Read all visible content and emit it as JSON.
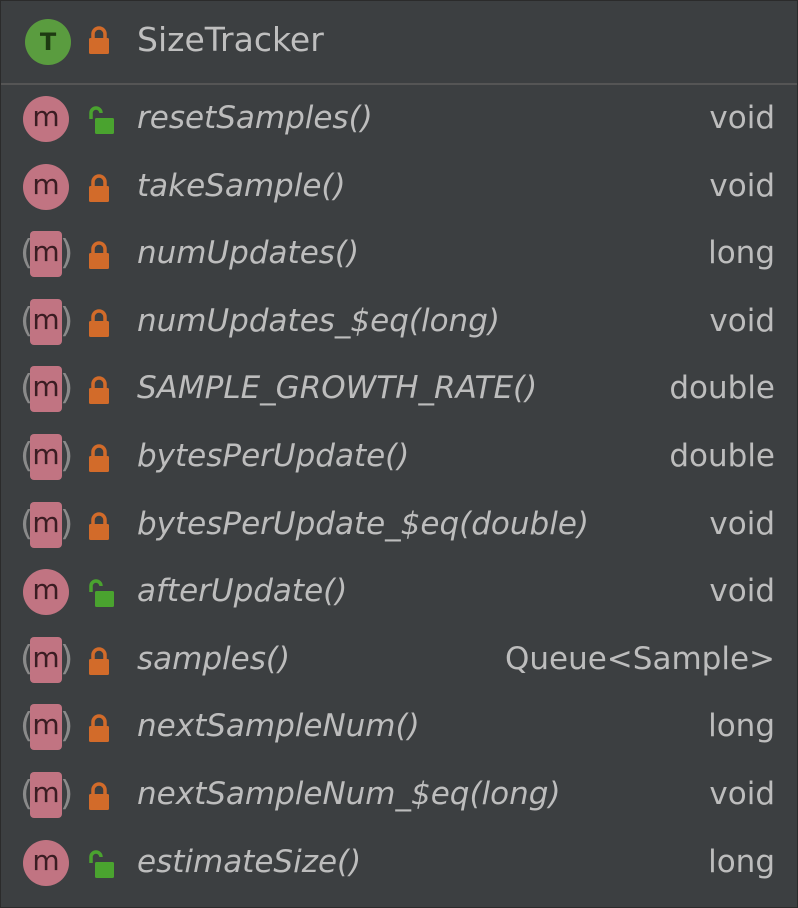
{
  "header": {
    "title": "SizeTracker",
    "class_badge": "T",
    "class_icon": "class-trait-icon",
    "access_icon": "private-lock-icon"
  },
  "colors": {
    "background": "#3c3f41",
    "method_badge": "#c17482",
    "class_badge": "#5a9c3f",
    "lock_private": "#d26b2a",
    "lock_public": "#4aa32f"
  },
  "members": [
    {
      "name": "resetSamples()",
      "type": "void",
      "badge": "m",
      "access": "public",
      "kind": "method"
    },
    {
      "name": "takeSample()",
      "type": "void",
      "badge": "m",
      "access": "private",
      "kind": "method"
    },
    {
      "name": "numUpdates()",
      "type": "long",
      "badge": "m",
      "access": "private",
      "kind": "abstract-method"
    },
    {
      "name": "numUpdates_$eq(long)",
      "type": "void",
      "badge": "m",
      "access": "private",
      "kind": "abstract-method"
    },
    {
      "name": "SAMPLE_GROWTH_RATE()",
      "type": "double",
      "badge": "m",
      "access": "private",
      "kind": "abstract-method"
    },
    {
      "name": "bytesPerUpdate()",
      "type": "double",
      "badge": "m",
      "access": "private",
      "kind": "abstract-method"
    },
    {
      "name": "bytesPerUpdate_$eq(double)",
      "type": "void",
      "badge": "m",
      "access": "private",
      "kind": "abstract-method"
    },
    {
      "name": "afterUpdate()",
      "type": "void",
      "badge": "m",
      "access": "public",
      "kind": "method"
    },
    {
      "name": "samples()",
      "type": "Queue<Sample>",
      "badge": "m",
      "access": "private",
      "kind": "abstract-method"
    },
    {
      "name": "nextSampleNum()",
      "type": "long",
      "badge": "m",
      "access": "private",
      "kind": "abstract-method"
    },
    {
      "name": "nextSampleNum_$eq(long)",
      "type": "void",
      "badge": "m",
      "access": "private",
      "kind": "abstract-method"
    },
    {
      "name": "estimateSize()",
      "type": "long",
      "badge": "m",
      "access": "public",
      "kind": "method"
    }
  ]
}
